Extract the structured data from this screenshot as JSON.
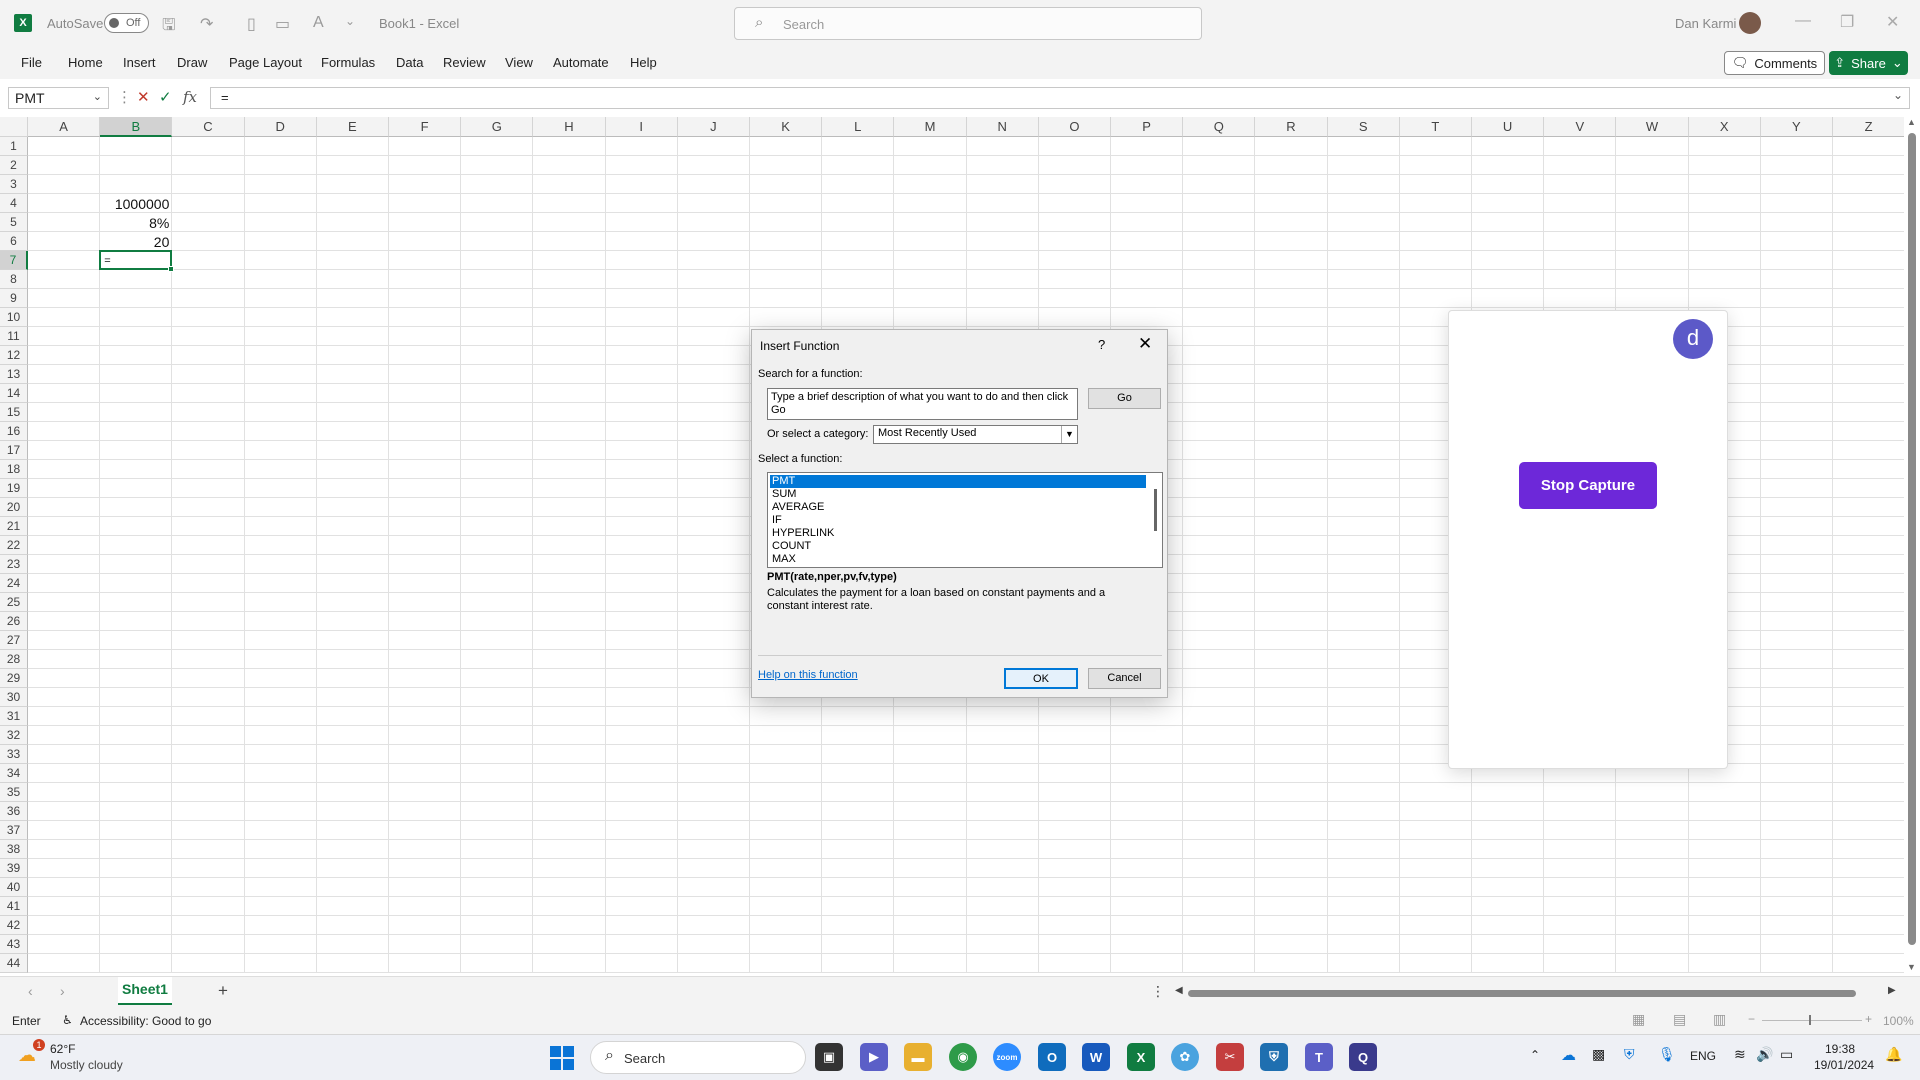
{
  "titlebar": {
    "autosave_label": "AutoSave",
    "autosave_state": "Off",
    "doc_title": "Book1  -  Excel",
    "search_placeholder": "Search",
    "user_name": "Dan Karmi"
  },
  "menu": [
    "File",
    "Home",
    "Insert",
    "Draw",
    "Page Layout",
    "Formulas",
    "Data",
    "Review",
    "View",
    "Automate",
    "Help"
  ],
  "actions": {
    "comments": "Comments",
    "share": "Share"
  },
  "formula_bar": {
    "name_box": "PMT",
    "formula": "="
  },
  "grid": {
    "columns": [
      "A",
      "B",
      "C",
      "D",
      "E",
      "F",
      "G",
      "H",
      "I",
      "J",
      "K",
      "L",
      "M",
      "N",
      "O",
      "P",
      "Q",
      "R",
      "S",
      "T",
      "U",
      "V",
      "W",
      "X",
      "Y",
      "Z"
    ],
    "row_count": 44,
    "selected_column": "B",
    "selected_row": 7,
    "cells": [
      {
        "col": "B",
        "row": 4,
        "value": "1000000"
      },
      {
        "col": "B",
        "row": 5,
        "value": "8%"
      },
      {
        "col": "B",
        "row": 6,
        "value": "20"
      },
      {
        "col": "B",
        "row": 7,
        "value": "="
      }
    ]
  },
  "sheets": {
    "active": "Sheet1"
  },
  "status": {
    "mode": "Enter",
    "accessibility": "Accessibility: Good to go",
    "zoom": "100%"
  },
  "dialog": {
    "title": "Insert Function",
    "help": "?",
    "search_label": "Search for a function:",
    "search_text": "Type a brief description of what you want to do and then click Go",
    "go_label": "Go",
    "category_label": "Or select a category:",
    "category_value": "Most Recently Used",
    "function_label": "Select a function:",
    "functions": [
      "PMT",
      "SUM",
      "AVERAGE",
      "IF",
      "HYPERLINK",
      "COUNT",
      "MAX"
    ],
    "selected_function": "PMT",
    "syntax": "PMT(rate,nper,pv,fv,type)",
    "description": "Calculates the payment for a loan based on constant payments and a constant interest rate.",
    "help_link": "Help on this function",
    "ok_label": "OK",
    "cancel_label": "Cancel"
  },
  "capture_panel": {
    "avatar_letter": "d",
    "stop_label": "Stop Capture"
  },
  "taskbar": {
    "weather_temp": "62°F",
    "weather_desc": "Mostly cloudy",
    "weather_badge": "1",
    "search_label": "Search",
    "lang": "ENG",
    "time": "19:38",
    "date": "19/01/2024"
  }
}
